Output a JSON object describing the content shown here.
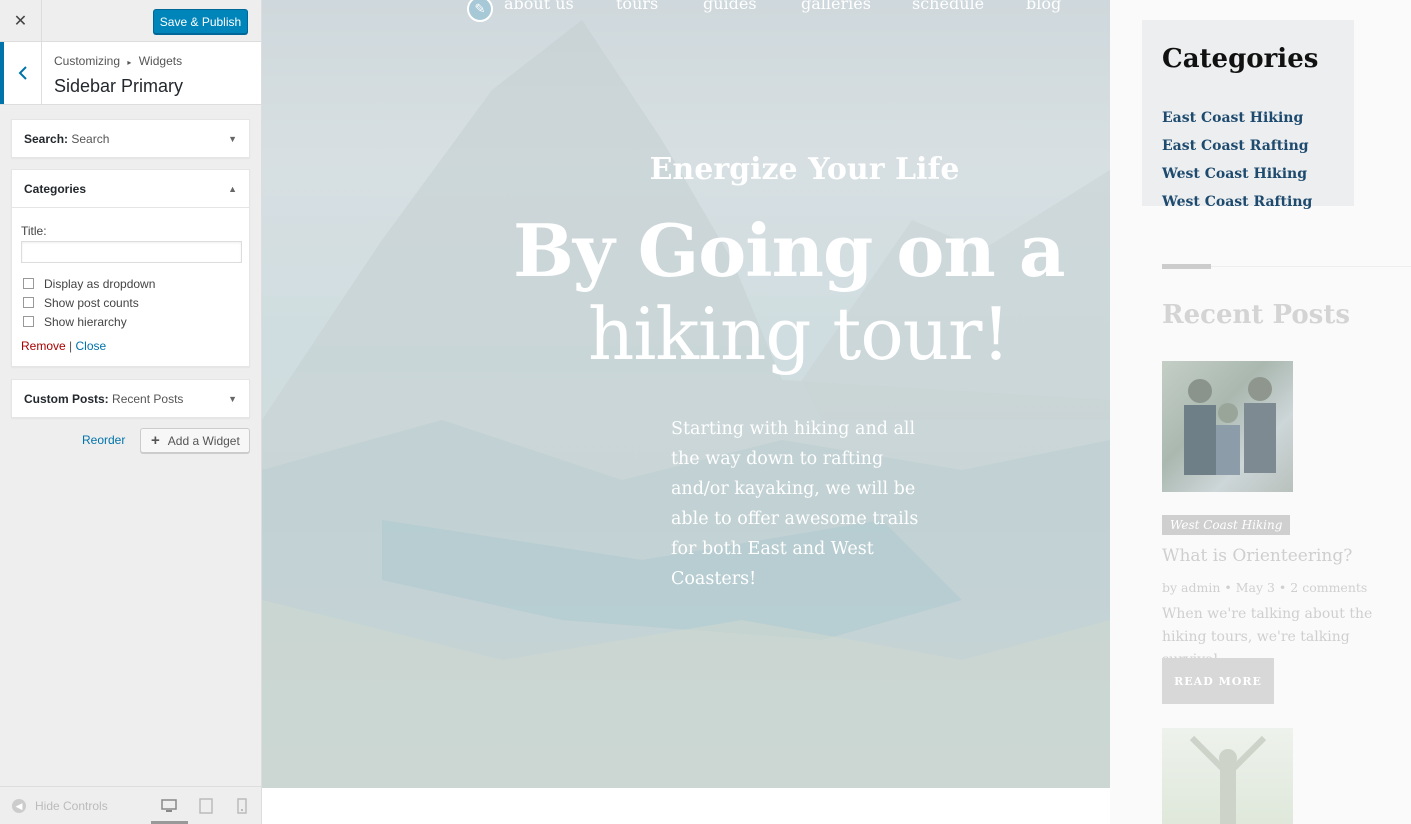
{
  "controls": {
    "close_label": "✕",
    "publish_label": "Save & Publish",
    "breadcrumb_root": "Customizing",
    "breadcrumb_sep": "▸",
    "breadcrumb_section": "Widgets",
    "panel_title": "Sidebar Primary",
    "widgets": [
      {
        "name": "Search:",
        "sub": "Search",
        "arrow": "▼"
      },
      {
        "name": "Categories",
        "sub": "",
        "arrow": "▲"
      },
      {
        "name": "Custom Posts:",
        "sub": "Recent Posts",
        "arrow": "▼"
      }
    ],
    "categories_form": {
      "title_label": "Title:",
      "title_value": "",
      "options": [
        "Display as dropdown",
        "Show post counts",
        "Show hierarchy"
      ],
      "remove": "Remove",
      "sep": "|",
      "close": "Close"
    },
    "reorder": "Reorder",
    "add_widget": "Add a Widget",
    "hide_controls": "Hide Controls"
  },
  "preview": {
    "nav": [
      "about us",
      "tours",
      "guides",
      "galleries",
      "schedule",
      "blog"
    ],
    "hero": {
      "eyebrow": "Energize Your Life",
      "line1": "By Going on a",
      "line2": "hiking tour!",
      "body": "Starting with hiking and all the way down to rafting and/or kayaking, we will be able to offer awesome trails for both East and West Coasters!"
    },
    "sidebar": {
      "categories_title": "Categories",
      "categories": [
        "East Coast Hiking",
        "East Coast Rafting",
        "West Coast Hiking",
        "West Coast Rafting"
      ],
      "recent_title": "Recent Posts",
      "post": {
        "tag": "West Coast Hiking",
        "title": "What is Orienteering?",
        "meta": "by admin  •  May 3  •  2 comments",
        "excerpt": "When we're talking about the hiking tours, we're talking survival...",
        "read_more": "READ MORE"
      }
    }
  },
  "colors": {
    "accent": "#0085ba",
    "link": "#0073aa",
    "remove": "#a00",
    "cat_link": "#1d4a6e"
  }
}
